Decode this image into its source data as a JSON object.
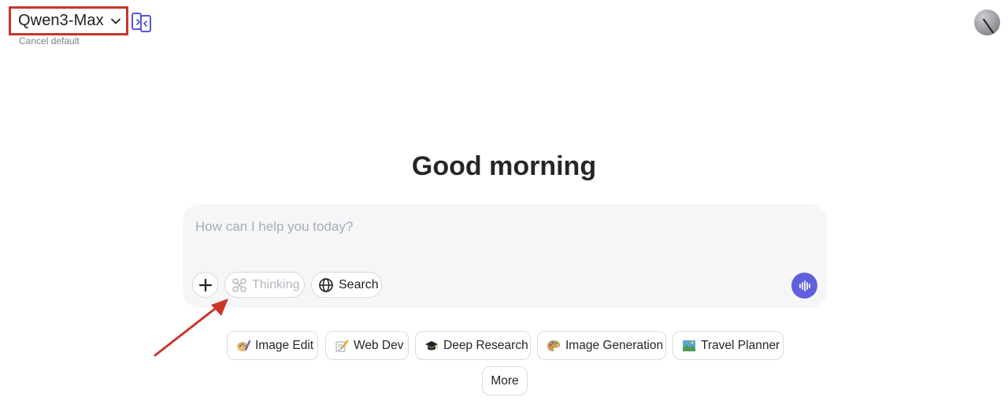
{
  "header": {
    "model_name": "Qwen3-Max",
    "cancel_default": "Cancel default"
  },
  "greeting": "Good morning",
  "composer": {
    "placeholder": "How can I help you today?",
    "thinking_label": "Thinking",
    "search_label": "Search"
  },
  "suggestions": [
    {
      "label": "Image Edit",
      "icon": "paint-palette-pencil-icon"
    },
    {
      "label": "Web Dev",
      "icon": "memo-pencil-icon"
    },
    {
      "label": "Deep Research",
      "icon": "graduation-cap-icon"
    },
    {
      "label": "Image Generation",
      "icon": "artist-palette-icon"
    },
    {
      "label": "Travel Planner",
      "icon": "map-picture-icon"
    }
  ],
  "more_label": "More",
  "colors": {
    "accent": "#6160dc",
    "highlight_box": "#c8362b",
    "composer_bg": "#f5f6f8"
  }
}
